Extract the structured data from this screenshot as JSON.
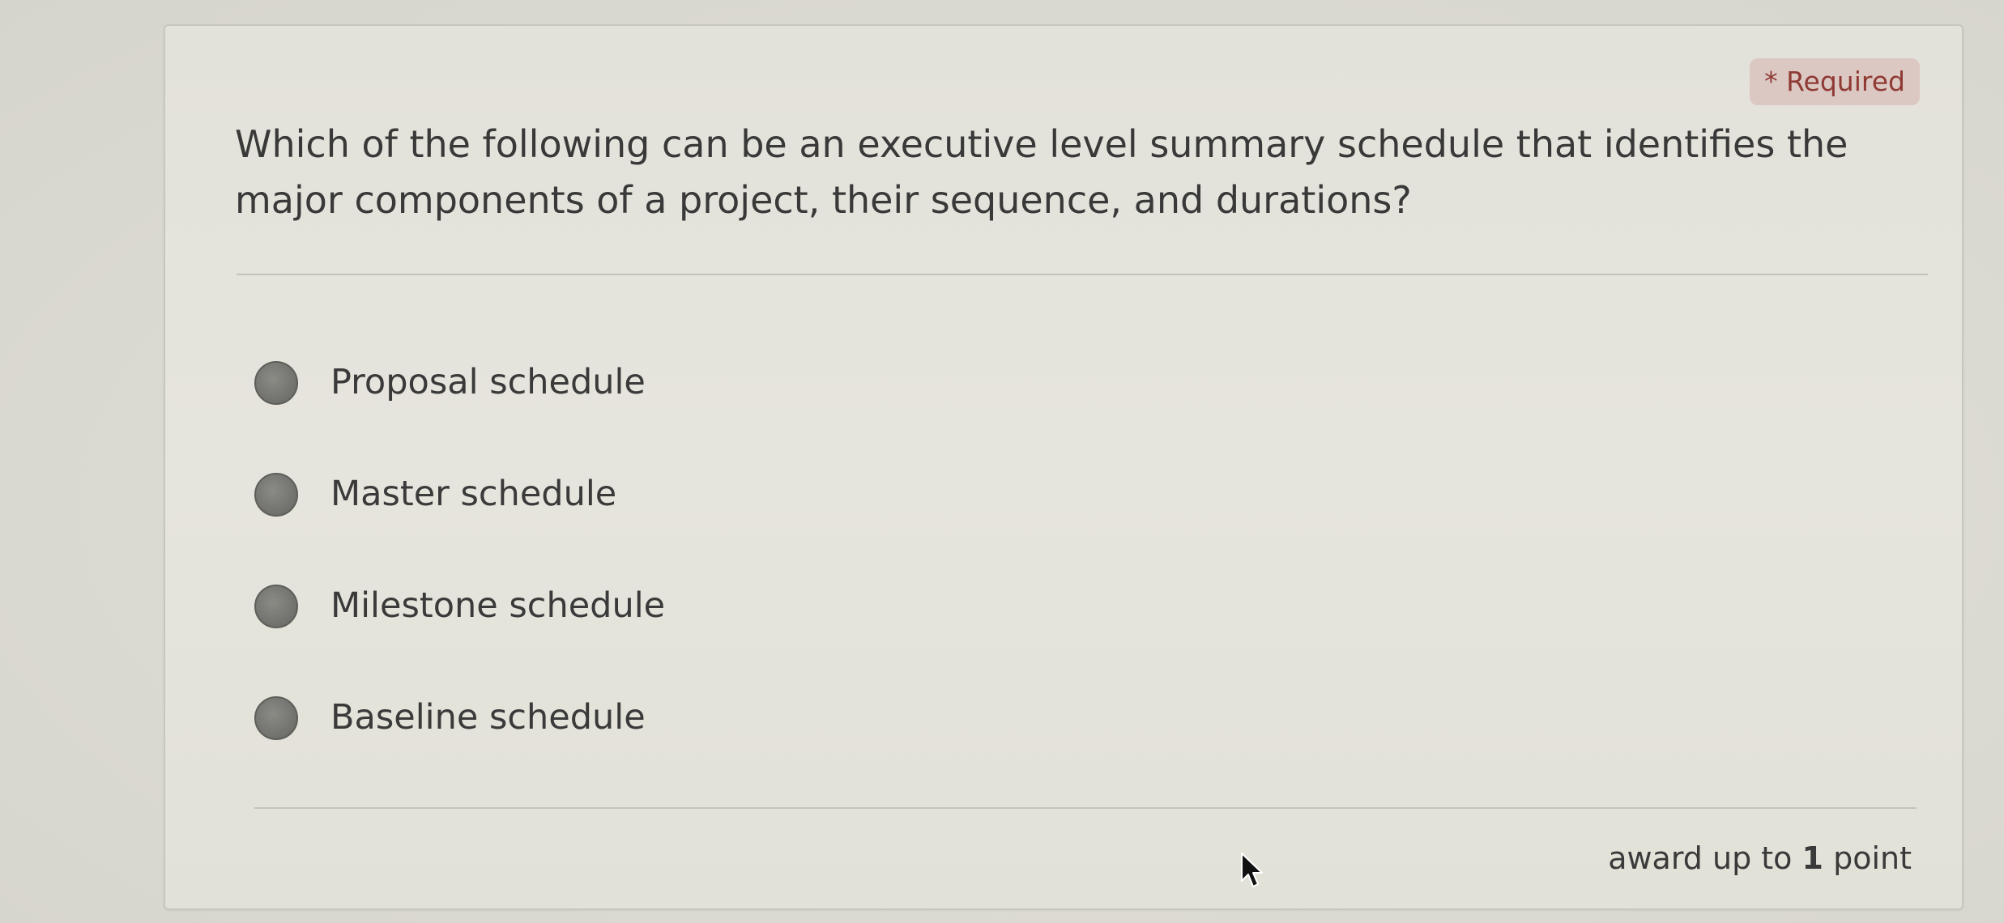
{
  "question": {
    "required_label": "* Required",
    "text": "Which of the following can be an executive level summary schedule that identifies the major components of a project, their sequence, and durations?",
    "options": [
      {
        "label": "Proposal schedule"
      },
      {
        "label": "Master schedule"
      },
      {
        "label": "Milestone schedule"
      },
      {
        "label": "Baseline schedule"
      }
    ],
    "award_prefix": "award up to",
    "award_points": "1",
    "award_suffix": "point"
  },
  "icons": {
    "radio": "radio-button-icon",
    "cursor": "mouse-pointer-icon"
  },
  "colors": {
    "required_text": "#8f3a34",
    "required_bg": "#dcc8c3",
    "radio_fill": "#727270",
    "text": "#3a3a3a"
  }
}
